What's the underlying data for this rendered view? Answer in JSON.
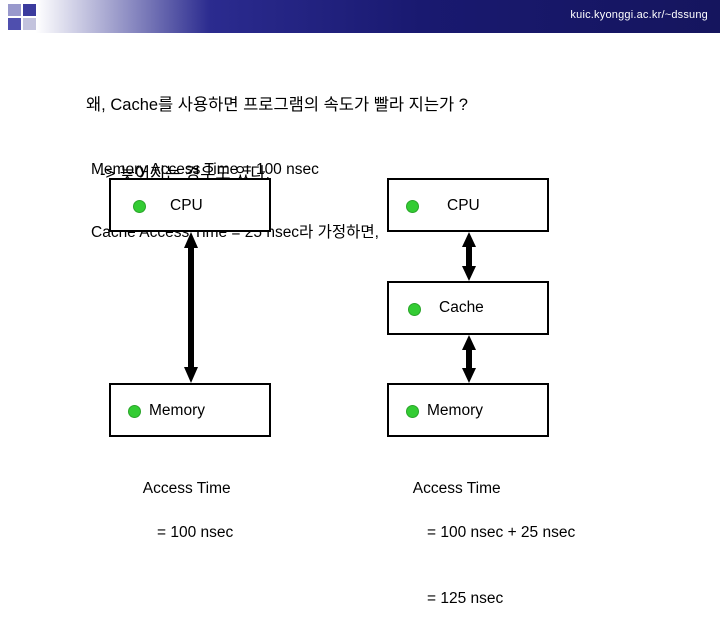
{
  "header": {
    "url": "kuic.kyonggi.ac.kr/~dssung"
  },
  "title": {
    "line1": "왜, Cache를 사용하면 프로그램의 속도가 빨라 지는가 ?",
    "line2": "-> 늦어지는 경우도 있다."
  },
  "assumption": {
    "line1": "Memory Access Time = 100 nsec",
    "line2": "Cache Access Time = 25 nsec라 가정하면,"
  },
  "diagram": {
    "left": {
      "boxes": [
        {
          "label": "CPU"
        },
        {
          "label": "Memory"
        }
      ],
      "caption": {
        "line1": "Access Time",
        "line2": "= 100 nsec"
      }
    },
    "right": {
      "boxes": [
        {
          "label": "CPU"
        },
        {
          "label": "Cache"
        },
        {
          "label": "Memory"
        }
      ],
      "caption": {
        "line1": "Access Time",
        "line2": "= 100 nsec + 25 nsec",
        "line3": "= 125 nsec"
      }
    }
  },
  "colors": {
    "bullet": "#33cc33",
    "band_dark": "#191970",
    "arrow": "#000000"
  }
}
